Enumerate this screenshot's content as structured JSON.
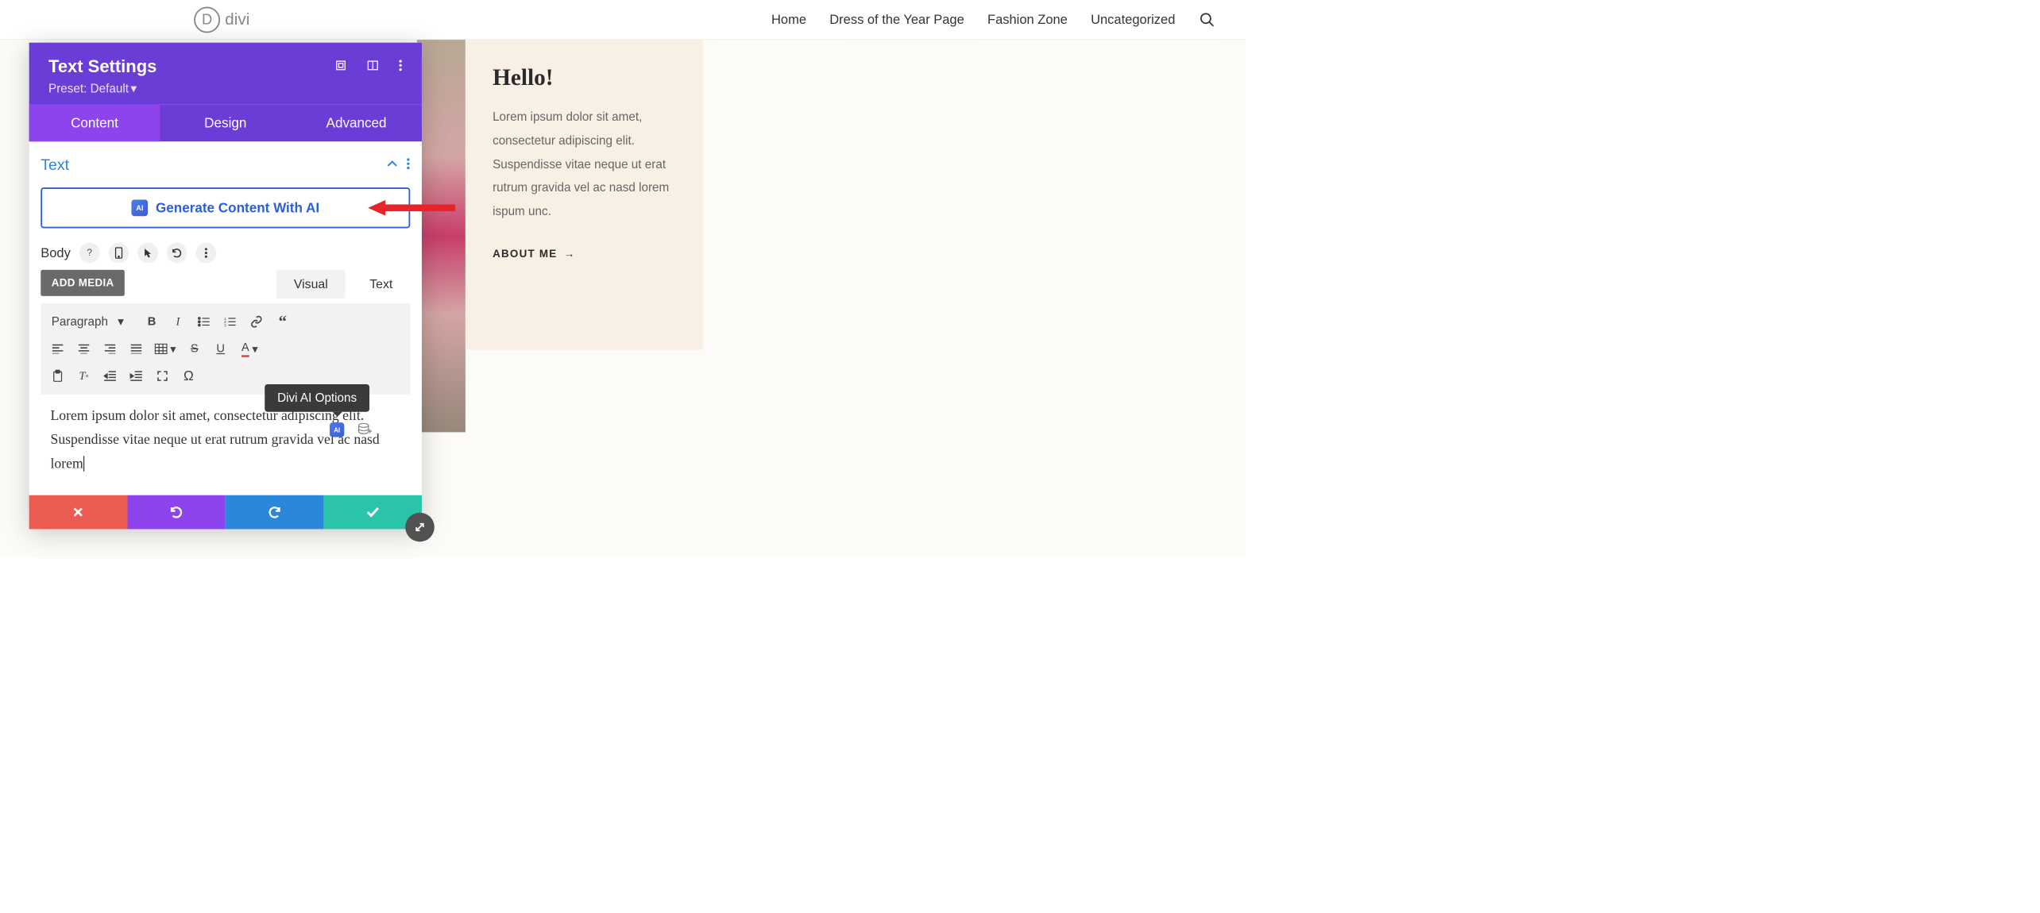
{
  "header": {
    "logo_letter": "D",
    "logo_text": "divi",
    "nav": [
      "Home",
      "Dress of the Year Page",
      "Fashion Zone",
      "Uncategorized"
    ]
  },
  "page": {
    "hello_title": "Hello!",
    "hello_text": "Lorem ipsum dolor sit amet, consectetur adipiscing elit. Suspendisse vitae neque ut erat rutrum gravida vel ac nasd lorem ispum unc.",
    "about_label": "ABOUT ME"
  },
  "panel": {
    "title": "Text Settings",
    "preset_label": "Preset: Default",
    "tabs": {
      "content": "Content",
      "design": "Design",
      "advanced": "Advanced"
    },
    "section_title": "Text",
    "ai_button_label": "Generate Content With AI",
    "ai_badge": "AI",
    "body_label": "Body",
    "add_media": "ADD MEDIA",
    "editor_tabs": {
      "visual": "Visual",
      "text": "Text"
    },
    "format_select": "Paragraph",
    "editor_text": "Lorem ipsum dolor sit amet, consectetur adipiscing elit. Suspendisse vitae neque ut erat rutrum gravida vel ac nasd lorem",
    "tooltip": "Divi AI Options"
  }
}
